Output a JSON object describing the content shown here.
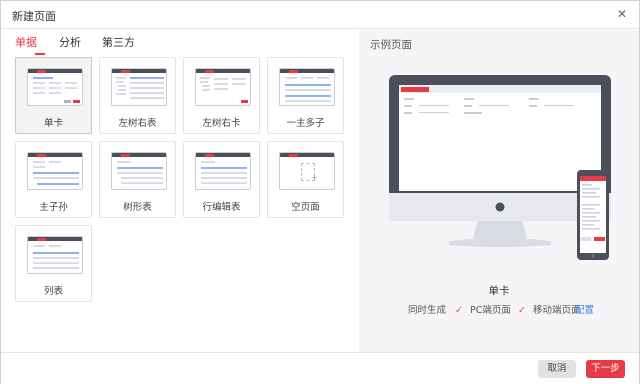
{
  "dialog": {
    "title": "新建页面",
    "close_glyph": "✕"
  },
  "tabs": [
    {
      "label": "单据",
      "active": true
    },
    {
      "label": "分析",
      "active": false
    },
    {
      "label": "第三方",
      "active": false
    }
  ],
  "templates": [
    {
      "label": "单卡",
      "selected": true
    },
    {
      "label": "左树右表",
      "selected": false
    },
    {
      "label": "左树右卡",
      "selected": false
    },
    {
      "label": "一主多子",
      "selected": false
    },
    {
      "label": "主子孙",
      "selected": false
    },
    {
      "label": "树形表",
      "selected": false
    },
    {
      "label": "行编辑表",
      "selected": false
    },
    {
      "label": "空页面",
      "selected": false
    },
    {
      "label": "列表",
      "selected": false
    }
  ],
  "preview": {
    "heading": "示例页面",
    "page_name": "单卡",
    "generate_label": "同时生成",
    "pc_label": "PC端页面",
    "mobile_label": "移动端页面",
    "config_link": "配置",
    "check_glyph": "✓"
  },
  "footer": {
    "cancel_label": "取消",
    "next_label": "下一步"
  },
  "colors": {
    "accent": "#e63b46",
    "link": "#3d84e0",
    "panel_bg": "#f5f5f7",
    "device_dark": "#4b4f5a"
  }
}
